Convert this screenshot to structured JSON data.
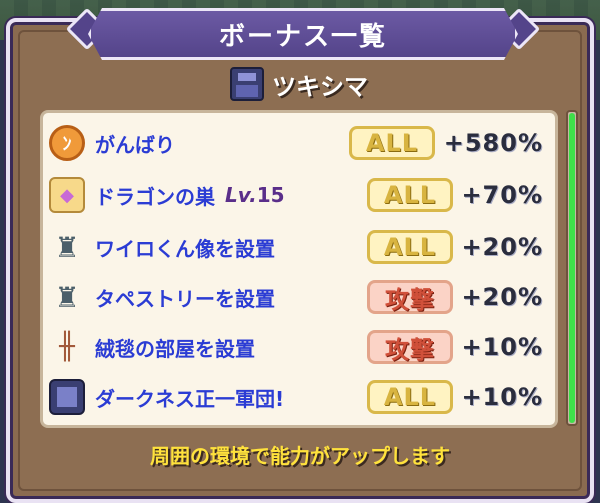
{
  "header": {
    "title": "ボーナス一覧"
  },
  "character": {
    "name": "ツキシマ",
    "icon": "character-portrait-icon"
  },
  "bonuses": [
    {
      "icon": "ganbari-icon",
      "icon_glyph": "ﾝ",
      "label": "がんばり",
      "level_prefix": "",
      "level": "",
      "target": "ALL",
      "value": "+580%"
    },
    {
      "icon": "dragon-nest-icon",
      "icon_glyph": "◆",
      "label": "ドラゴンの巣",
      "level_prefix": "Lv.",
      "level": "15",
      "target": "ALL",
      "value": "+70%"
    },
    {
      "icon": "statue-icon",
      "icon_glyph": "♜",
      "label": "ワイロくん像を設置",
      "level_prefix": "",
      "level": "",
      "target": "ALL",
      "value": "+20%"
    },
    {
      "icon": "statue-icon",
      "icon_glyph": "♜",
      "label": "タペストリーを設置",
      "level_prefix": "",
      "level": "",
      "target": "攻撃",
      "value": "+20%"
    },
    {
      "icon": "carpet-icon",
      "icon_glyph": "╫",
      "label": "絨毯の部屋を設置",
      "level_prefix": "",
      "level": "",
      "target": "攻撃",
      "value": "+10%"
    },
    {
      "icon": "dark-army-icon",
      "icon_glyph": "",
      "label": "ダークネス正一軍団!",
      "level_prefix": "",
      "level": "",
      "target": "ALL",
      "value": "+10%"
    }
  ],
  "footer": {
    "text": "周囲の環境で能力がアップします"
  },
  "colors": {
    "panel": "#8a6b50",
    "title_bar": "#6c5aa4",
    "label_blue": "#2b3cd4",
    "all_badge": "#d8b440",
    "attack_badge": "#d0503a",
    "scrollbar": "#3fe04a",
    "footer_text": "#ffe23c"
  }
}
